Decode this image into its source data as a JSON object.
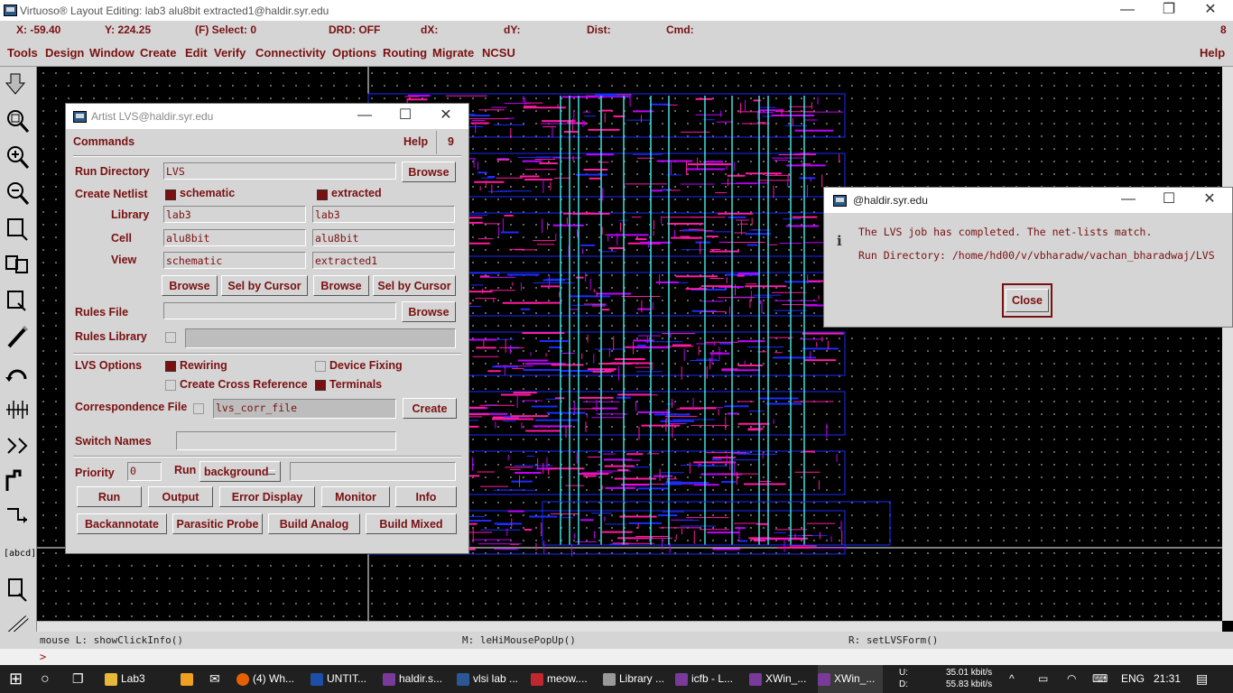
{
  "window": {
    "title": "Virtuoso® Layout Editing: lab3 alu8bit extracted1@haldir.syr.edu",
    "min": "—",
    "max": "❐",
    "close": "✕"
  },
  "coords": {
    "x": "X: -59.40",
    "y": "Y: 224.25",
    "select": "(F) Select: 0",
    "drd": "DRD: OFF",
    "dx": "dX:",
    "dy": "dY:",
    "dist": "Dist:",
    "cmd": "Cmd:",
    "count": "8"
  },
  "menu": [
    "Tools",
    "Design",
    "Window",
    "Create",
    "Edit",
    "Verify",
    "Connectivity",
    "Options",
    "Routing",
    "Migrate",
    "NCSU"
  ],
  "menu_help": "Help",
  "toolbar_icons": [
    "save-icon",
    "fit-icon",
    "zoom-in-icon",
    "zoom-out-icon",
    "stretch-icon",
    "copy-icon",
    "move-icon",
    "delete-icon",
    "undo-icon",
    "ruler-icon",
    "path-icon",
    "polygon-icon",
    "label-icon",
    "property-icon",
    "measure-icon"
  ],
  "label_tool": "[abcd]",
  "status": {
    "left": "mouse L: showClickInfo()",
    "mid": "M: leHiMousePopUp()",
    "right": "R: setLVSForm()"
  },
  "cmdline": ">",
  "lvs": {
    "title": "Artist LVS@haldir.syr.edu",
    "commands": "Commands",
    "help": "Help",
    "num": "9",
    "run_dir_label": "Run Directory",
    "run_dir": "LVS",
    "browse": "Browse",
    "create_netlist": "Create Netlist",
    "schematic": "schematic",
    "extracted": "extracted",
    "library_label": "Library",
    "cell_label": "Cell",
    "view_label": "View",
    "lib_s": "lab3",
    "lib_e": "lab3",
    "cell_s": "alu8bit",
    "cell_e": "alu8bit",
    "view_s": "schematic",
    "view_e": "extracted1",
    "sel_by_cursor": "Sel by Cursor",
    "rules_file": "Rules File",
    "rules_library": "Rules Library",
    "lvs_options": "LVS Options",
    "rewiring": "Rewiring",
    "device_fixing": "Device Fixing",
    "cross_ref": "Create Cross Reference",
    "terminals": "Terminals",
    "corr_file_label": "Correspondence File",
    "corr_file": "lvs_corr_file",
    "create": "Create",
    "switch_names": "Switch Names",
    "priority": "Priority",
    "priority_val": "0",
    "run_label": "Run",
    "run_mode": "background",
    "buttons1": [
      "Run",
      "Output",
      "Error Display",
      "Monitor",
      "Info"
    ],
    "buttons2": [
      "Backannotate",
      "Parasitic Probe",
      "Build Analog",
      "Build Mixed"
    ]
  },
  "msg": {
    "title": "@haldir.syr.edu",
    "line1": "The LVS job has completed. The net-lists match.",
    "line2": "Run Directory: /home/hd00/v/vbharadw/vachan_bharadwaj/LVS",
    "close": "Close"
  },
  "taskbar": {
    "apps": [
      "Lab3",
      "",
      "",
      "(4) Wh...",
      "UNTIT...",
      "haldir.s...",
      "vlsi lab ...",
      "meow....",
      "Library ...",
      "icfb - L...",
      "XWin_...",
      "XWin_..."
    ],
    "net_u": "U:",
    "net_d": "D:",
    "up": "35.01 kbit/s",
    "down": "55.83 kbit/s",
    "lang": "ENG",
    "time": "21:31"
  },
  "colors": {
    "accent": "#7a1010",
    "panel": "#d5d5d5",
    "metal1": "#1a2cff",
    "metal2": "#ff1aa0",
    "poly": "#c000ff",
    "via": "#40e0e0"
  }
}
